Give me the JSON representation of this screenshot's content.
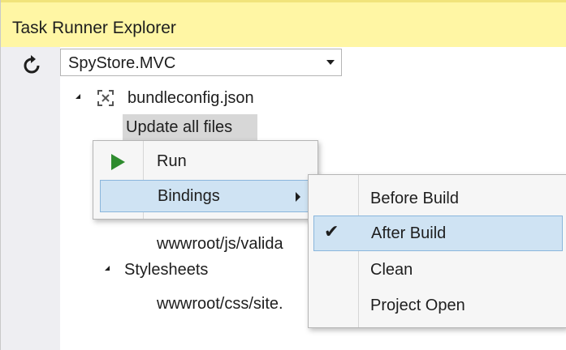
{
  "window": {
    "title": "Task Runner Explorer"
  },
  "toolbar": {
    "refresh_icon": "refresh-icon",
    "project_select": "SpyStore.MVC"
  },
  "tree": {
    "root_label": "bundleconfig.json",
    "root_icon": "bundle-config-icon",
    "selected_task": "Update all files",
    "file_validate": "wwwroot/js/valida",
    "group_stylesheets": "Stylesheets",
    "file_site": "wwwroot/css/site."
  },
  "context_menu": {
    "items": [
      {
        "label": "Run",
        "icon": "play-icon"
      },
      {
        "label": "Bindings",
        "icon": "chevron-right-icon"
      }
    ]
  },
  "bindings_submenu": {
    "items": [
      {
        "label": "Before Build",
        "checked": false
      },
      {
        "label": "After Build",
        "checked": true
      },
      {
        "label": "Clean",
        "checked": false
      },
      {
        "label": "Project Open",
        "checked": false
      }
    ]
  },
  "colors": {
    "title_bg": "#fff6a4",
    "highlight": "#cfe3f3",
    "run_green": "#2f8c2f"
  }
}
